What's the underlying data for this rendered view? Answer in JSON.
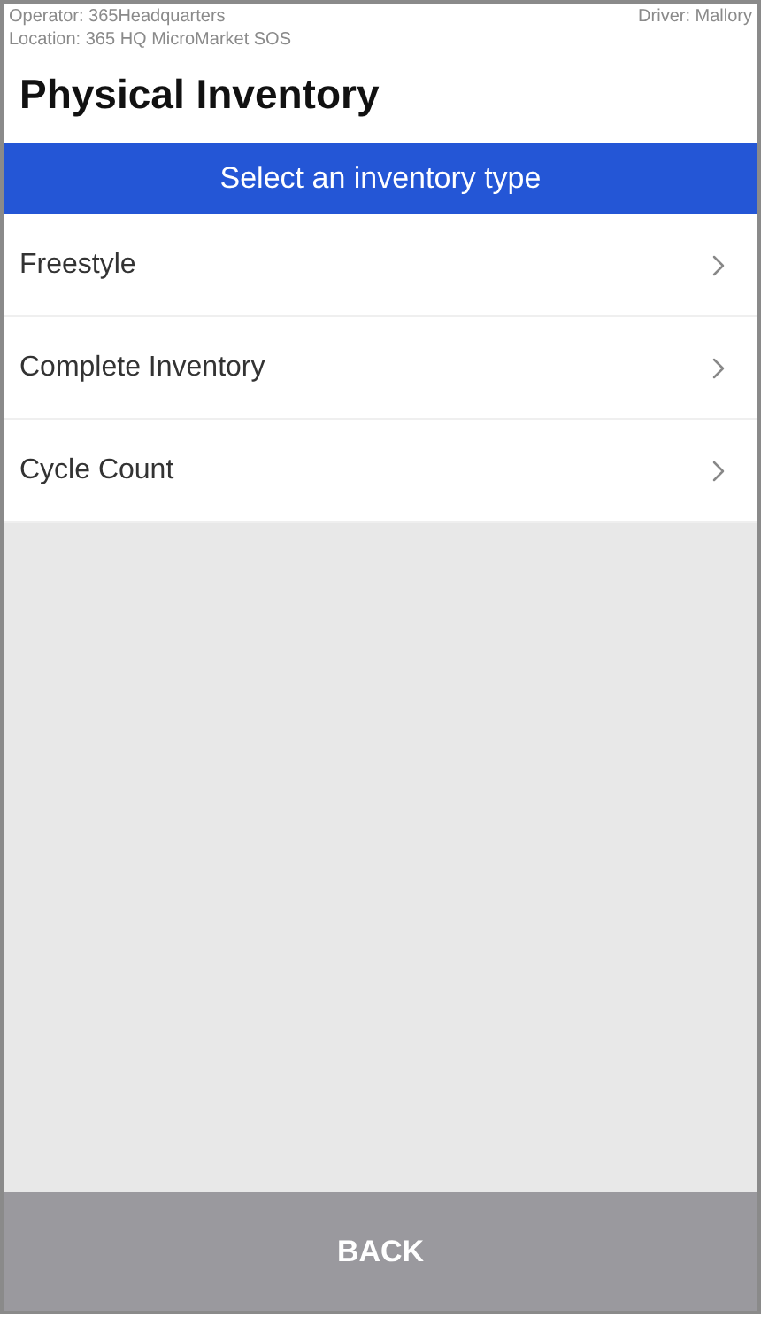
{
  "header": {
    "operator": "Operator: 365Headquarters",
    "driver": "Driver: Mallory",
    "location": "Location: 365 HQ MicroMarket SOS"
  },
  "title": "Physical Inventory",
  "banner": "Select an inventory type",
  "items": [
    {
      "label": "Freestyle"
    },
    {
      "label": "Complete Inventory"
    },
    {
      "label": "Cycle Count"
    }
  ],
  "back_button": "BACK"
}
